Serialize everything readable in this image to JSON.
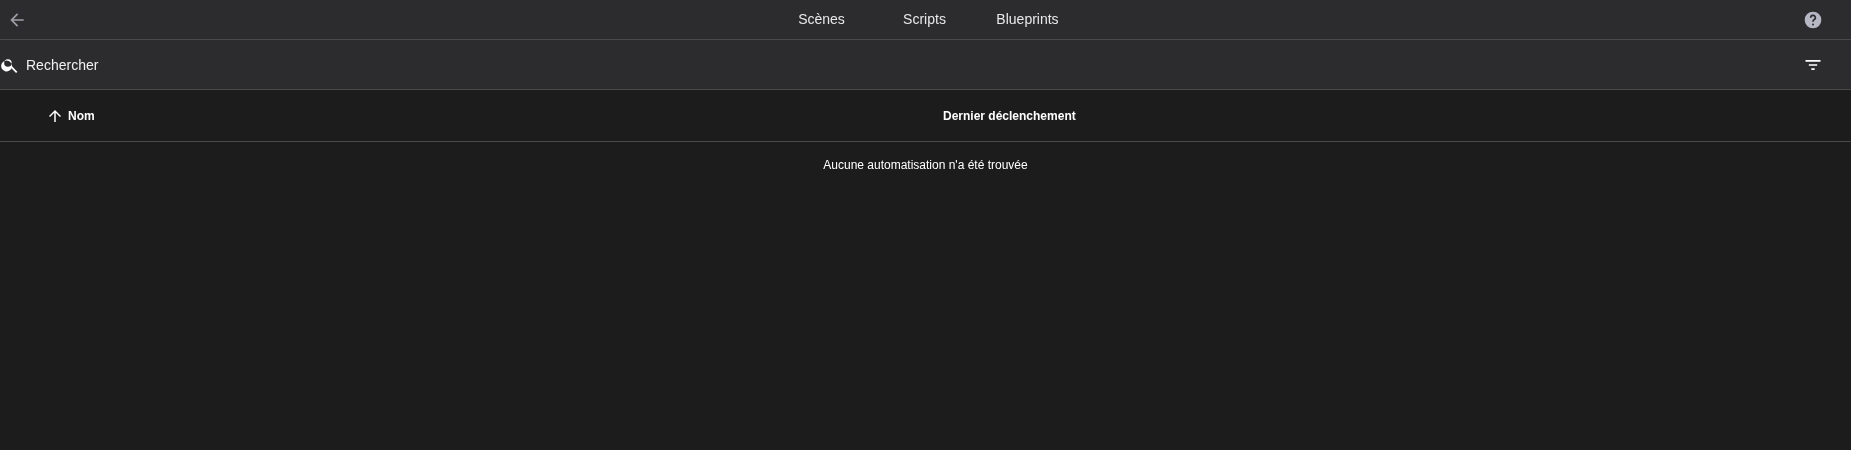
{
  "tabs": [
    {
      "label": "Scènes",
      "selected": false
    },
    {
      "label": "Scripts",
      "selected": false
    },
    {
      "label": "Blueprints",
      "selected": false
    }
  ],
  "search": {
    "placeholder": "Rechercher"
  },
  "table": {
    "columns": [
      {
        "label": "Nom",
        "sorted_ascending": true
      },
      {
        "label": "Dernier déclenchement"
      }
    ],
    "empty_message": "Aucune automatisation n'a été trouvée"
  }
}
